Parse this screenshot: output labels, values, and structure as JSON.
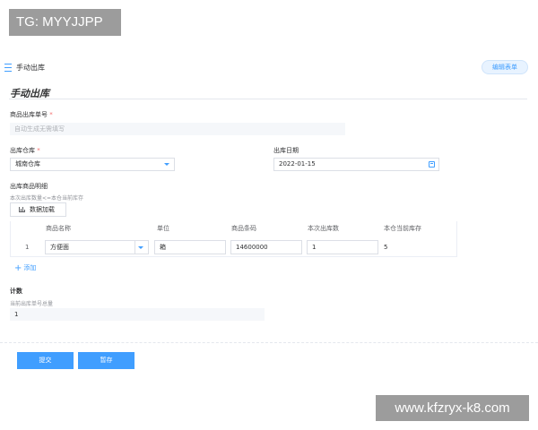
{
  "watermarks": {
    "top_left": "TG: MYYJJPP",
    "bottom_right": "www.kfzryx-k8.com"
  },
  "topbar": {
    "title": "手动出库",
    "edit_form_button": "编辑表单"
  },
  "page": {
    "title": "手动出库"
  },
  "order_no": {
    "label": "商品出库单号",
    "required_mark": "*",
    "placeholder": "自动生成无需填写"
  },
  "warehouse": {
    "label": "出库仓库",
    "required_mark": "*",
    "value": "城南仓库"
  },
  "date": {
    "label": "出库日期",
    "value": "2022-01-15"
  },
  "details": {
    "label": "出库商品明细",
    "hint": "本次出库数量<=本仓当前库存",
    "load_button": "数据加载",
    "columns": [
      "商品名称",
      "单位",
      "商品条码",
      "本次出库数",
      "本仓当前库存"
    ],
    "rows": [
      {
        "index": "1",
        "name": "方便面",
        "unit": "箱",
        "barcode": "14600000",
        "quantity": "1",
        "stock": "5"
      }
    ],
    "add_label": "添加"
  },
  "count": {
    "title": "计数",
    "label": "当前出库单号总量",
    "value": "1"
  },
  "actions": {
    "submit": "提交",
    "save_draft": "暂存"
  },
  "colors": {
    "accent": "#409eff",
    "required": "#f56c6c",
    "watermark": "#9c9c9c"
  },
  "icons": [
    "menu-icon",
    "calendar-icon",
    "chart-icon",
    "chevron-down-icon",
    "plus-icon"
  ]
}
